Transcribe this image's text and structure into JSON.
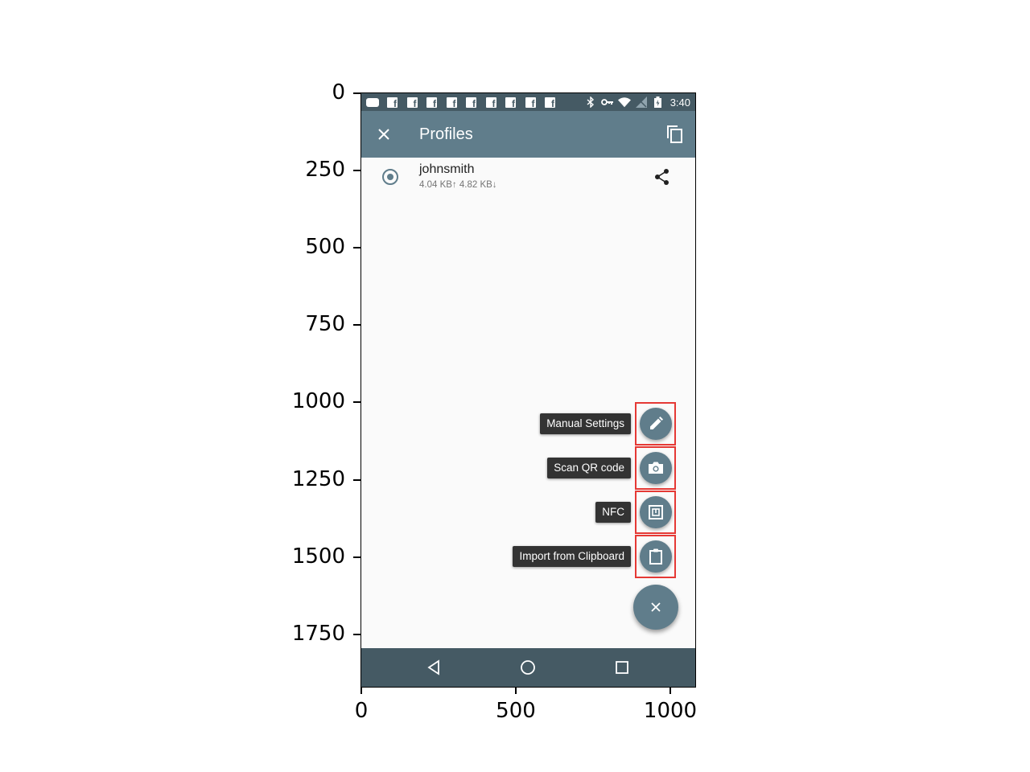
{
  "axes": {
    "y_ticks": [
      "0",
      "250",
      "500",
      "750",
      "1000",
      "1250",
      "1500",
      "1750"
    ],
    "x_ticks": [
      "0",
      "500",
      "1000"
    ]
  },
  "status_bar": {
    "time": "3:40",
    "icons": [
      "message-icon",
      "facebook-icon",
      "bluetooth-icon",
      "vpn-key-icon",
      "wifi-icon",
      "no-signal-icon",
      "battery-icon"
    ]
  },
  "app_bar": {
    "title": "Profiles"
  },
  "profiles": [
    {
      "name": "johnsmith",
      "traffic": "4.04 KB↑ 4.82 KB↓",
      "selected": true
    }
  ],
  "fab_menu": {
    "items": [
      {
        "label": "Manual Settings",
        "icon": "pencil-icon"
      },
      {
        "label": "Scan QR code",
        "icon": "camera-icon"
      },
      {
        "label": "NFC",
        "icon": "nfc-icon"
      },
      {
        "label": "Import from Clipboard",
        "icon": "clipboard-icon"
      }
    ],
    "main_icon": "close-icon"
  },
  "colors": {
    "primary": "#607d8b",
    "primary_dark": "#455a64",
    "highlight": "#e53935",
    "label_bg": "#333333"
  }
}
